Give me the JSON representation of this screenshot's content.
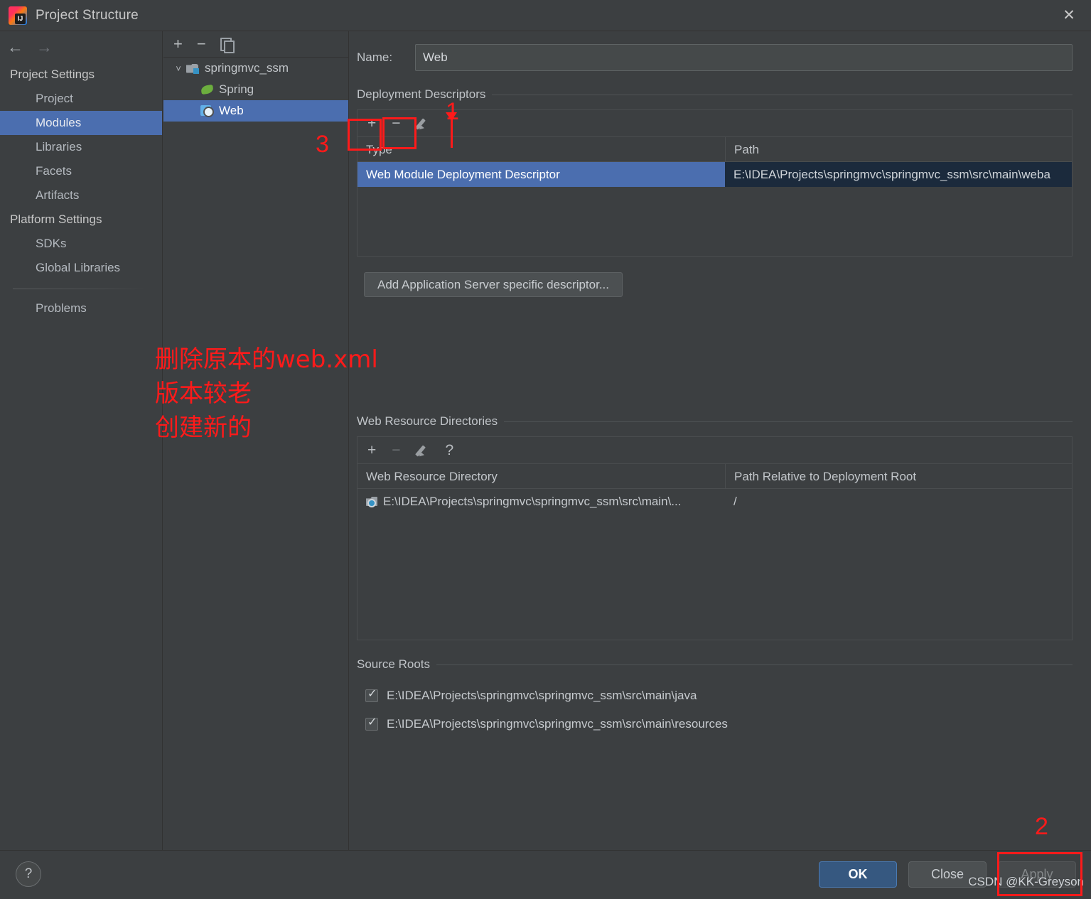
{
  "window": {
    "title": "Project Structure",
    "close_label": "✕",
    "app_icon": "intellij-idea-logo"
  },
  "nav": {
    "back": "←",
    "forward": "→"
  },
  "sidebar": {
    "groups": [
      {
        "label": "Project Settings",
        "items": [
          {
            "label": "Project",
            "selected": false
          },
          {
            "label": "Modules",
            "selected": true
          },
          {
            "label": "Libraries",
            "selected": false
          },
          {
            "label": "Facets",
            "selected": false
          },
          {
            "label": "Artifacts",
            "selected": false
          }
        ]
      },
      {
        "label": "Platform Settings",
        "items": [
          {
            "label": "SDKs",
            "selected": false
          },
          {
            "label": "Global Libraries",
            "selected": false
          }
        ]
      }
    ],
    "problems_label": "Problems"
  },
  "tree": {
    "toolbar": {
      "add": "+",
      "remove": "−",
      "copy": "copy-icon"
    },
    "nodes": [
      {
        "label": "springmvc_ssm",
        "icon": "module-icon",
        "level": 0,
        "expanded": true,
        "selected": false
      },
      {
        "label": "Spring",
        "icon": "spring-leaf-icon",
        "level": 1,
        "selected": false
      },
      {
        "label": "Web",
        "icon": "web-icon",
        "level": 1,
        "selected": true
      }
    ]
  },
  "main": {
    "name_label": "Name:",
    "name_value": "Web",
    "deployment": {
      "section_title": "Deployment Descriptors",
      "toolbar": {
        "add": "+",
        "remove": "−",
        "edit": "pencil-icon"
      },
      "columns": [
        "Type",
        "Path"
      ],
      "rows": [
        {
          "type": "Web Module Deployment Descriptor",
          "path": "E:\\IDEA\\Projects\\springmvc\\springmvc_ssm\\src\\main\\weba",
          "selected": true
        }
      ],
      "add_server_descriptor_label": "Add Application Server specific descriptor..."
    },
    "web_resource": {
      "section_title": "Web Resource Directories",
      "toolbar": {
        "add": "+",
        "remove": "−",
        "edit": "pencil-icon",
        "help": "?"
      },
      "columns": [
        "Web Resource Directory",
        "Path Relative to Deployment Root"
      ],
      "rows": [
        {
          "directory": "E:\\IDEA\\Projects\\springmvc\\springmvc_ssm\\src\\main\\...",
          "relative_path": "/"
        }
      ]
    },
    "source_roots": {
      "section_title": "Source Roots",
      "items": [
        {
          "path": "E:\\IDEA\\Projects\\springmvc\\springmvc_ssm\\src\\main\\java",
          "checked": true
        },
        {
          "path": "E:\\IDEA\\Projects\\springmvc\\springmvc_ssm\\src\\main\\resources",
          "checked": true
        }
      ]
    }
  },
  "footer": {
    "help": "?",
    "ok": "OK",
    "close": "Close",
    "apply": "Apply",
    "watermark": "CSDN @KK-Greyson"
  },
  "annotations": {
    "color": "#ff1a1a",
    "num_1": "1",
    "num_2": "2",
    "num_3": "3",
    "chinese_note": "删除原本的web.xml\n版本较老\n创建新的"
  }
}
